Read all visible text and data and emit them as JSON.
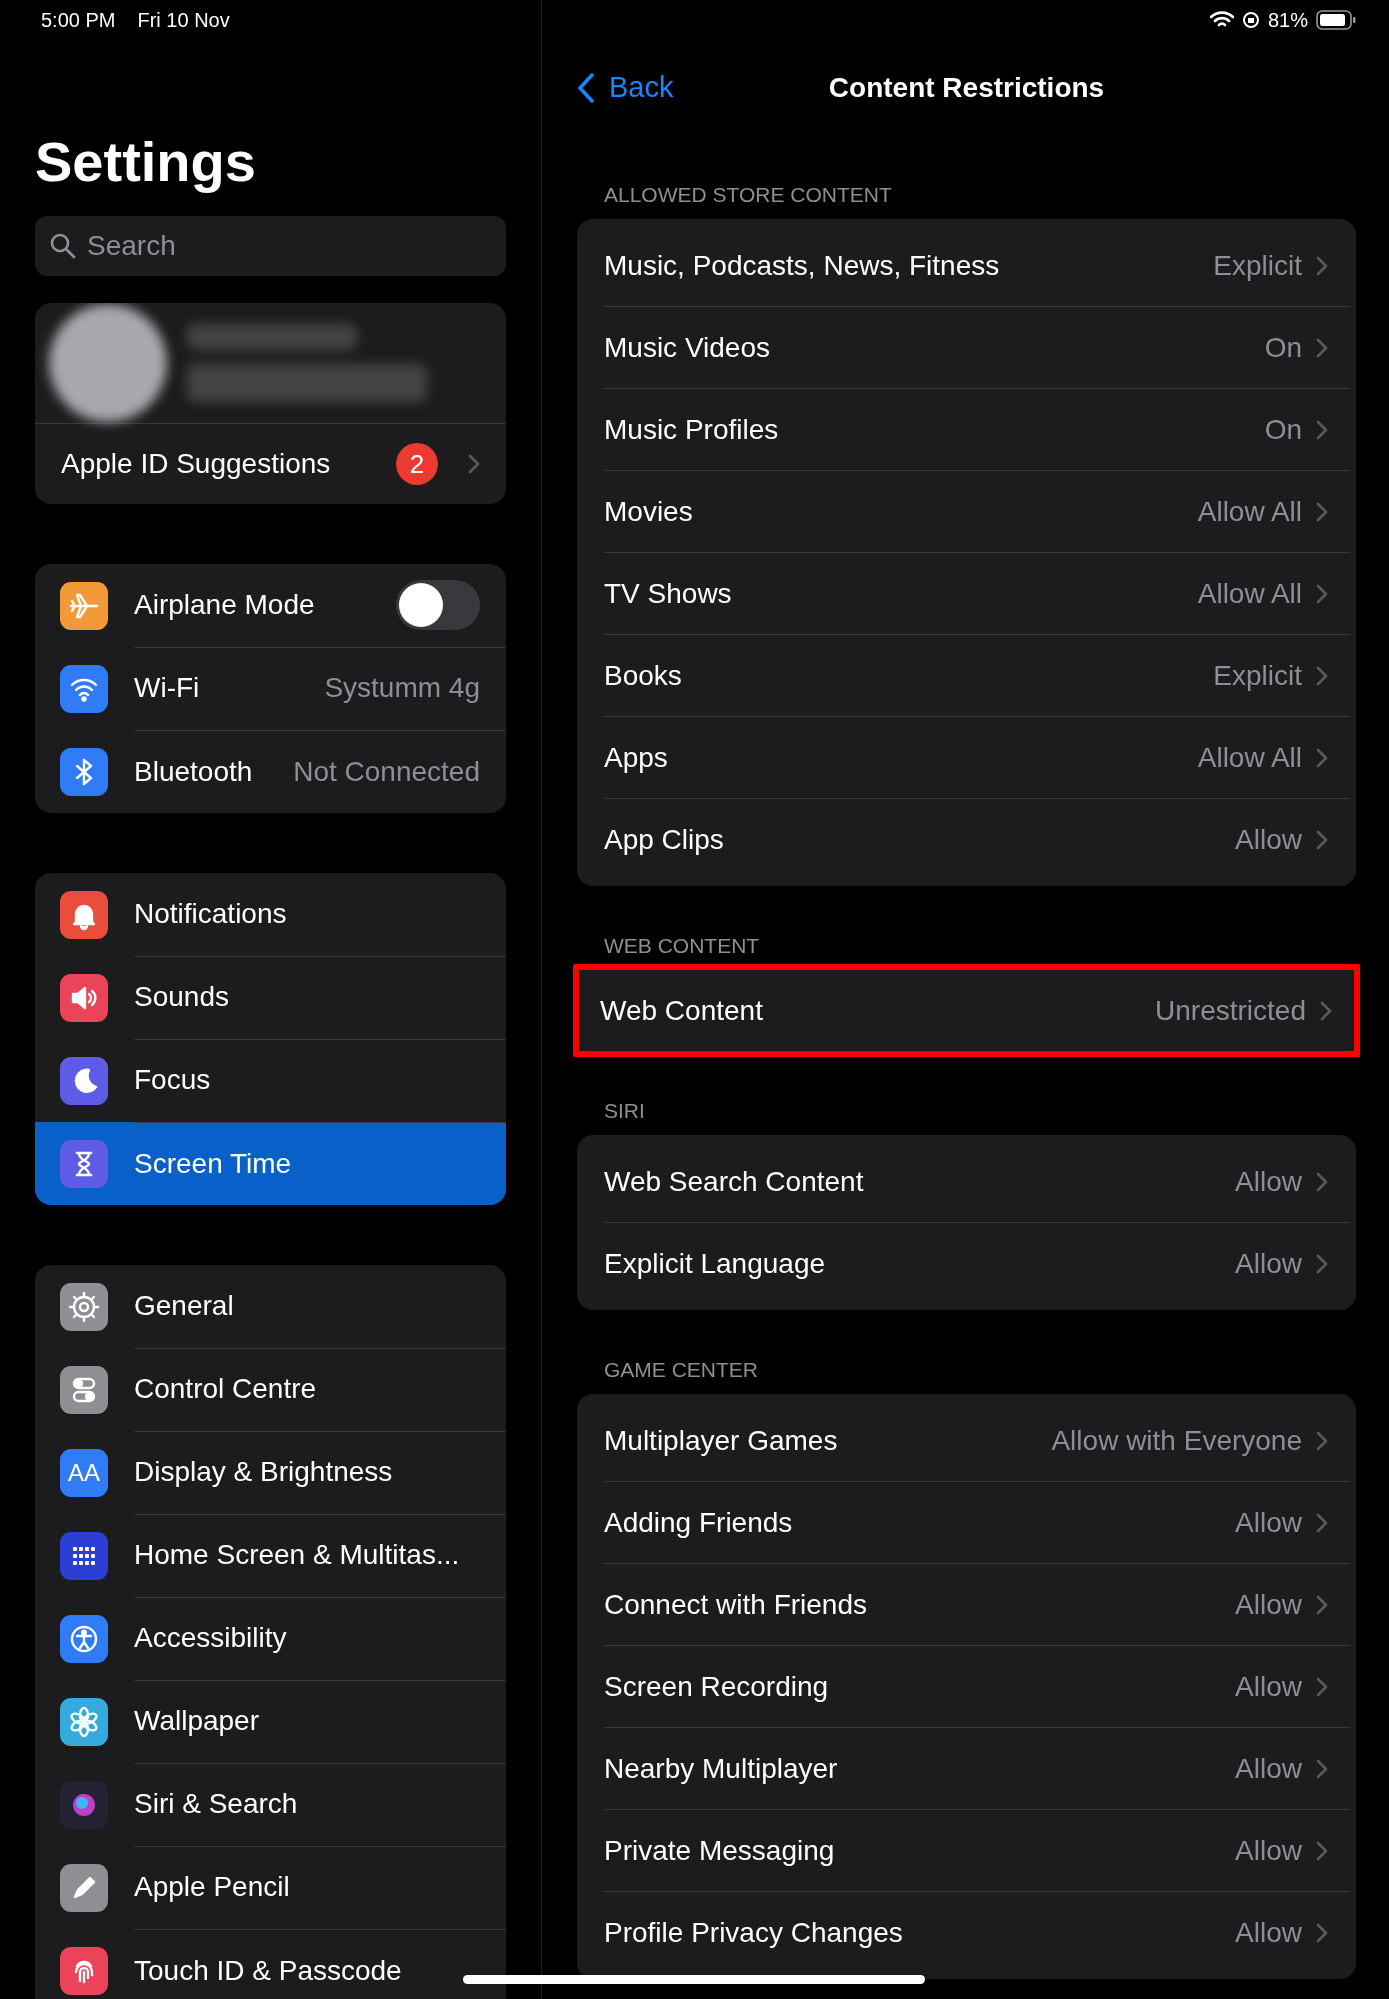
{
  "status_bar": {
    "time": "5:00 PM",
    "date": "Fri 10 Nov",
    "battery": "81%"
  },
  "sidebar": {
    "title": "Settings",
    "search": {
      "placeholder": "Search"
    },
    "account": {
      "suggestions": "Apple ID Suggestions",
      "badge": "2"
    },
    "groups": [
      {
        "items": [
          {
            "kind": "toggle",
            "label": "Airplane Mode",
            "color": "#f19a37",
            "on": false,
            "selected": false
          },
          {
            "kind": "value",
            "label": "Wi-Fi",
            "value": "Systumm 4g",
            "color": "#2f7cf6",
            "selected": false
          },
          {
            "kind": "value",
            "label": "Bluetooth",
            "value": "Not Connected",
            "color": "#2f7cf6",
            "selected": false
          }
        ]
      },
      {
        "items": [
          {
            "kind": "plain",
            "label": "Notifications",
            "color": "#eb4d3d",
            "selected": false
          },
          {
            "kind": "plain",
            "label": "Sounds",
            "color": "#eb445a",
            "selected": false
          },
          {
            "kind": "plain",
            "label": "Focus",
            "color": "#5e5ce6",
            "selected": false
          },
          {
            "kind": "plain",
            "label": "Screen Time",
            "color": "#5e5ce6",
            "selected": true
          }
        ]
      },
      {
        "items": [
          {
            "kind": "plain",
            "label": "General",
            "color": "#8e8e93",
            "selected": false
          },
          {
            "kind": "plain",
            "label": "Control Centre",
            "color": "#8e8e93",
            "selected": false
          },
          {
            "kind": "plain",
            "label": "Display & Brightness",
            "color": "#2f7cf6",
            "icon_text": "AA",
            "selected": false
          },
          {
            "kind": "plain",
            "label": "Home Screen & Multitas...",
            "color": "#2c3fd4",
            "selected": false
          },
          {
            "kind": "plain",
            "label": "Accessibility",
            "color": "#2f7cf6",
            "selected": false
          },
          {
            "kind": "plain",
            "label": "Wallpaper",
            "color": "#35aadc",
            "selected": false
          },
          {
            "kind": "plain",
            "label": "Siri & Search",
            "color": "#222233",
            "selected": false
          },
          {
            "kind": "plain",
            "label": "Apple Pencil",
            "color": "#8e8e93",
            "selected": false
          },
          {
            "kind": "plain",
            "label": "Touch ID & Passcode",
            "color": "#eb445a",
            "selected": false
          }
        ]
      }
    ]
  },
  "detail": {
    "back": "Back",
    "title": "Content Restrictions",
    "sections": [
      {
        "header": "ALLOWED STORE CONTENT",
        "highlighted": false,
        "rows": [
          {
            "label": "Music, Podcasts, News, Fitness",
            "value": "Explicit"
          },
          {
            "label": "Music Videos",
            "value": "On"
          },
          {
            "label": "Music Profiles",
            "value": "On"
          },
          {
            "label": "Movies",
            "value": "Allow All"
          },
          {
            "label": "TV Shows",
            "value": "Allow All"
          },
          {
            "label": "Books",
            "value": "Explicit"
          },
          {
            "label": "Apps",
            "value": "Allow All"
          },
          {
            "label": "App Clips",
            "value": "Allow"
          }
        ]
      },
      {
        "header": "WEB CONTENT",
        "highlighted": true,
        "rows": [
          {
            "label": "Web Content",
            "value": "Unrestricted"
          }
        ]
      },
      {
        "header": "SIRI",
        "highlighted": false,
        "rows": [
          {
            "label": "Web Search Content",
            "value": "Allow"
          },
          {
            "label": "Explicit Language",
            "value": "Allow"
          }
        ]
      },
      {
        "header": "GAME CENTER",
        "highlighted": false,
        "rows": [
          {
            "label": "Multiplayer Games",
            "value": "Allow with Everyone"
          },
          {
            "label": "Adding Friends",
            "value": "Allow"
          },
          {
            "label": "Connect with Friends",
            "value": "Allow"
          },
          {
            "label": "Screen Recording",
            "value": "Allow"
          },
          {
            "label": "Nearby Multiplayer",
            "value": "Allow"
          },
          {
            "label": "Private Messaging",
            "value": "Allow"
          },
          {
            "label": "Profile Privacy Changes",
            "value": "Allow"
          }
        ]
      }
    ]
  }
}
